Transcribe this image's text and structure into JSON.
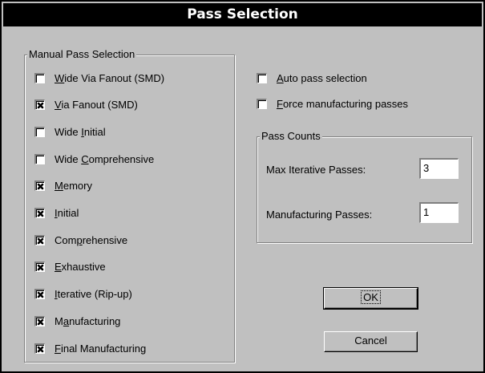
{
  "window": {
    "title": "Pass Selection"
  },
  "manual_group": {
    "label": "Manual Pass Selection",
    "items": [
      {
        "pre": "",
        "mn": "W",
        "post": "ide Via Fanout (SMD)",
        "checked": false
      },
      {
        "pre": "",
        "mn": "V",
        "post": "ia Fanout (SMD)",
        "checked": true
      },
      {
        "pre": "Wide ",
        "mn": "I",
        "post": "nitial",
        "checked": false
      },
      {
        "pre": "Wide ",
        "mn": "C",
        "post": "omprehensive",
        "checked": false
      },
      {
        "pre": "",
        "mn": "M",
        "post": "emory",
        "checked": true
      },
      {
        "pre": "",
        "mn": "I",
        "post": "nitial",
        "checked": true
      },
      {
        "pre": "Com",
        "mn": "p",
        "post": "rehensive",
        "checked": true
      },
      {
        "pre": "",
        "mn": "E",
        "post": "xhaustive",
        "checked": true
      },
      {
        "pre": "",
        "mn": "I",
        "post": "terative (Rip-up)",
        "checked": true
      },
      {
        "pre": "M",
        "mn": "a",
        "post": "nufacturing",
        "checked": true
      },
      {
        "pre": "",
        "mn": "F",
        "post": "inal Manufacturing",
        "checked": true
      }
    ]
  },
  "options": [
    {
      "pre": "",
      "mn": "A",
      "post": "uto pass selection",
      "checked": false
    },
    {
      "pre": "",
      "mn": "F",
      "post": "orce manufacturing passes",
      "checked": false
    }
  ],
  "pass_counts": {
    "label": "Pass Counts",
    "max_iterative_label": "Max Iterative Passes:",
    "max_iterative_value": "3",
    "manufacturing_label": "Manufacturing Passes:",
    "manufacturing_value": "1"
  },
  "buttons": {
    "ok": "OK",
    "cancel": "Cancel"
  }
}
